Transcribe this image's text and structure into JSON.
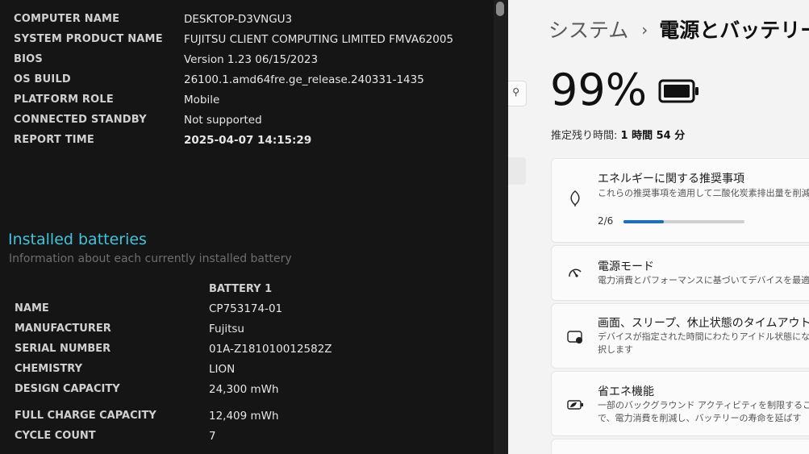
{
  "report": {
    "system": [
      {
        "key": "COMPUTER NAME",
        "value": "DESKTOP-D3VNGU3"
      },
      {
        "key": "SYSTEM PRODUCT NAME",
        "value": "FUJITSU CLIENT COMPUTING LIMITED FMVA62005"
      },
      {
        "key": "BIOS",
        "value": "Version 1.23 06/15/2023"
      },
      {
        "key": "OS BUILD",
        "value": "26100.1.amd64fre.ge_release.240331-1435"
      },
      {
        "key": "PLATFORM ROLE",
        "value": "Mobile"
      },
      {
        "key": "CONNECTED STANDBY",
        "value": "Not supported"
      },
      {
        "key": "REPORT TIME",
        "value": "2025-04-07  14:15:29"
      }
    ],
    "installed_title": "Installed batteries",
    "installed_subtitle": "Information about each currently installed battery",
    "battery_header": "BATTERY 1",
    "battery": [
      {
        "key": "NAME",
        "value": "CP753174-01"
      },
      {
        "key": "MANUFACTURER",
        "value": "Fujitsu"
      },
      {
        "key": "SERIAL NUMBER",
        "value": "01A-Z181010012582Z"
      },
      {
        "key": "CHEMISTRY",
        "value": "LION"
      },
      {
        "key": "DESIGN CAPACITY",
        "value": "24,300 mWh"
      },
      {
        "key": "FULL CHARGE CAPACITY",
        "value": "12,409 mWh"
      },
      {
        "key": "CYCLE COUNT",
        "value": "7"
      }
    ]
  },
  "settings": {
    "breadcrumb_parent": "システム",
    "breadcrumb_separator": "›",
    "breadcrumb_current": "電源とバッテリー",
    "battery_percent": "99%",
    "battery_icon": "battery-full-icon",
    "remaining_label": "推定残り時間:",
    "remaining_value": "1 時間 54 分",
    "search_icon": "search-icon",
    "cards": [
      {
        "icon": "leaf-icon",
        "title": "エネルギーに関する推奨事項",
        "desc": [
          "これらの推奨事項を適用して二酸化炭素排出量を削減"
        ],
        "progress_label": "2/6",
        "progress": 0.3333
      },
      {
        "icon": "power-mode-icon",
        "title": "電源モード",
        "desc": [
          "電力消費とパフォーマンスに基づいてデバイスを最適化"
        ]
      },
      {
        "icon": "screen-sleep-icon",
        "title": "画面、スリープ、休止状態のタイムアウト",
        "desc": [
          "デバイスが指定された時間にわたりアイドル状態になった",
          "択します"
        ]
      },
      {
        "icon": "battery-saver-icon",
        "title": "省エネ機能",
        "desc": [
          "一部のバックグラウンド アクティビティを制限すること",
          "で、電力消費を削減し、バッテリーの寿命を延ばす"
        ]
      }
    ]
  },
  "colors": {
    "report_bg": "#151515",
    "accent_cyan": "#3fc4dc",
    "progress_blue": "#1a6fc5",
    "settings_bg": "#f3f3f3"
  }
}
